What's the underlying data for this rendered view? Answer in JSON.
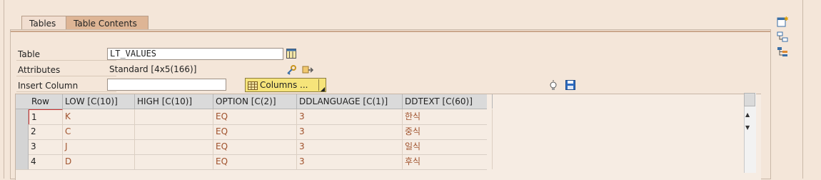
{
  "tabs": [
    {
      "label": "Tables",
      "active": false
    },
    {
      "label": "Table Contents",
      "active": true
    }
  ],
  "form": {
    "table_label": "Table",
    "table_value": "LT_VALUES",
    "attributes_label": "Attributes",
    "attributes_value": "Standard [4x5(166)]",
    "insert_column_label": "Insert Column",
    "insert_column_value": "",
    "columns_button_label": "Columns ..."
  },
  "grid": {
    "headers": [
      "Row",
      "LOW [C(10)]",
      "HIGH [C(10)]",
      "OPTION [C(2)]",
      "DDLANGUAGE [C(1)]",
      "DDTEXT [C(60)]"
    ],
    "rows": [
      [
        "1",
        "K",
        "",
        "EQ",
        "3",
        "한식"
      ],
      [
        "2",
        "C",
        "",
        "EQ",
        "3",
        "중식"
      ],
      [
        "3",
        "J",
        "",
        "EQ",
        "3",
        "일식"
      ],
      [
        "4",
        "D",
        "",
        "EQ",
        "3",
        "후식"
      ]
    ]
  },
  "colors": {
    "background": "#f4e6d9",
    "cell_text": "#a0522d",
    "header_bg": "#dadada",
    "columns_button_bg": "#f6e47a",
    "active_tab_bg": "#deb595"
  },
  "icons": {
    "table_picker": "table-icon",
    "attributes_key": "key-icon",
    "attributes_export": "export-icon",
    "columns": "columns-grid-icon",
    "clear": "bulb-icon",
    "save": "save-icon",
    "right_toolbar": [
      "new-entry-icon",
      "structure-icon",
      "hierarchy-icon"
    ]
  }
}
